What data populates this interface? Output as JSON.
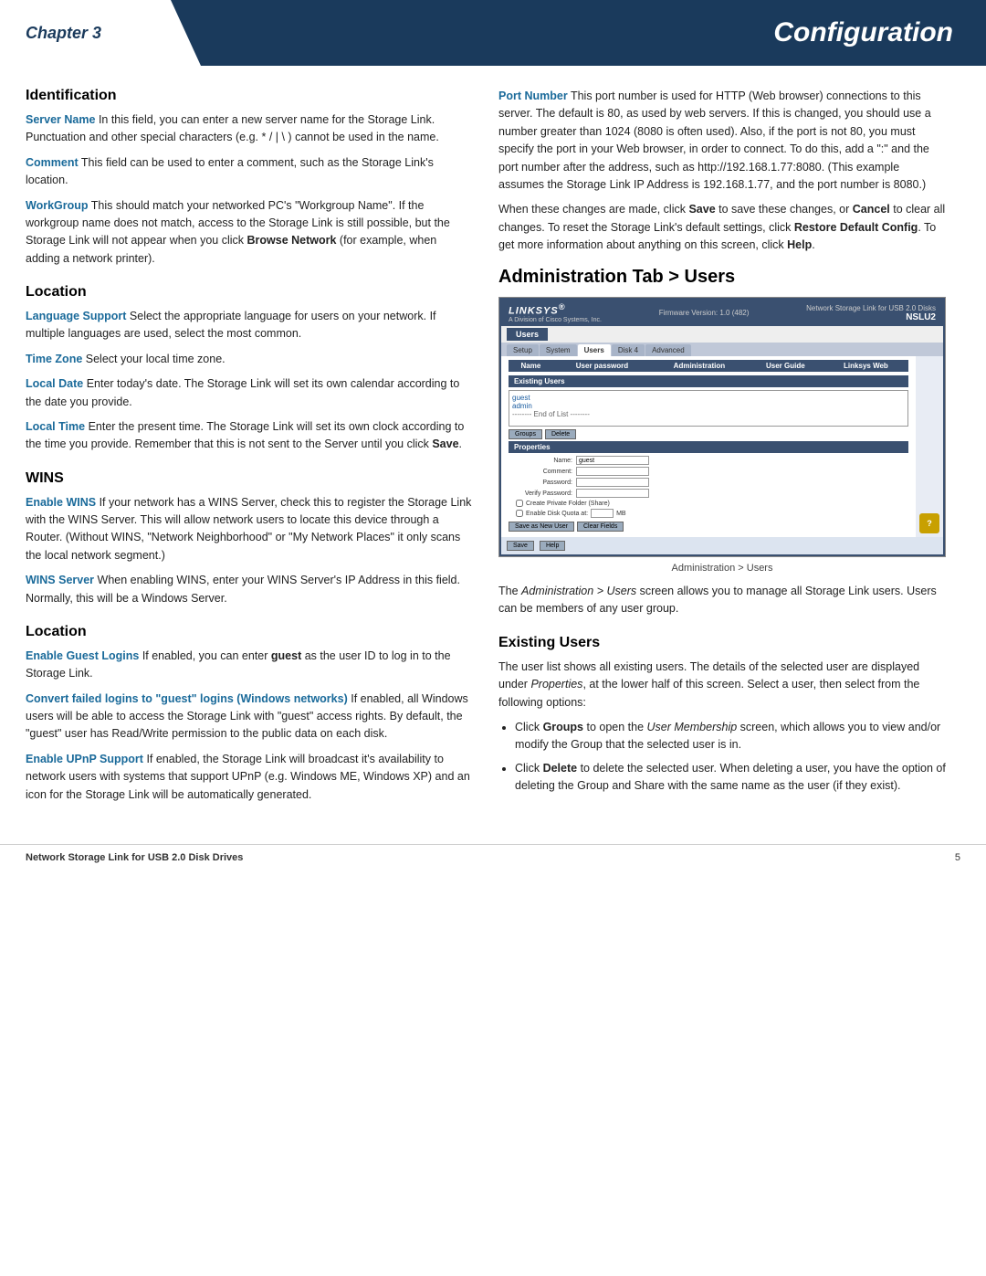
{
  "header": {
    "chapter_label": "Chapter 3",
    "config_title": "Configuration"
  },
  "left_col": {
    "sections": [
      {
        "id": "identification",
        "heading": "Identification",
        "paragraphs": [
          {
            "term": "Server Name",
            "text": " In this field, you can enter a new server name for the Storage Link. Punctuation and other special characters (e.g. * / | \\ ) cannot be used in the name."
          },
          {
            "term": "Comment",
            "text": " This field can be used to enter a comment, such as the Storage Link's location."
          },
          {
            "term": "WorkGroup",
            "text": " This should match your networked PC's \"Workgroup Name\". If the workgroup name does not match, access to the Storage Link is still possible, but the Storage Link will not appear when you click Browse Network (for example, when adding a network printer).",
            "browse_network_bold": true
          }
        ]
      },
      {
        "id": "location",
        "heading": "Location",
        "paragraphs": [
          {
            "term": "Language Support",
            "text": "  Select the appropriate language for users on your network. If multiple languages are used, select the most common."
          },
          {
            "term": "Time Zone",
            "text": "  Select your local time zone."
          },
          {
            "term": "Local Date",
            "text": "  Enter today's date. The Storage Link will set its own calendar according to the date you provide."
          },
          {
            "term": "Local Time",
            "text": " Enter the present time. The Storage Link will set its own clock according to the time you provide. Remember that this is not sent to the Server until you click Save.",
            "save_bold": true
          }
        ]
      },
      {
        "id": "wins",
        "heading": "WINS",
        "paragraphs": [
          {
            "term": "Enable WINS",
            "text": "  If your network has a WINS Server, check this to register the Storage Link with the WINS Server. This will allow network users to locate this device through a Router. (Without WINS, \"Network Neighborhood\" or \"My Network Places\" it only scans the local network segment.)"
          },
          {
            "term": "WINS Server",
            "text": " When enabling WINS, enter your WINS Server's IP Address in this field. Normally, this will be a Windows Server."
          }
        ]
      },
      {
        "id": "location2",
        "heading": "Location",
        "paragraphs": [
          {
            "term": "Enable Guest Logins",
            "text": "  If enabled, you can enter guest as the user ID to log in to the Storage Link.",
            "guest_bold": true
          },
          {
            "term": "Convert failed logins to \"guest\" logins (Windows networks)",
            "text": " If enabled, all Windows users will be able to access the Storage Link with \"guest\" access rights. By default, the \"guest\" user has Read/Write permission to the public data on each disk."
          },
          {
            "term": "Enable UPnP Support",
            "text": "  If enabled, the Storage Link will broadcast it's availability to network users with systems that support UPnP (e.g. Windows ME, Windows XP) and an icon for the Storage Link will be automatically generated."
          }
        ]
      }
    ]
  },
  "right_col": {
    "port_number_para": "Port Number  This port number is used for HTTP (Web browser) connections to this server. The default is 80, as used by web servers. If this is changed, you should use a number greater than 1024 (8080 is often used). Also, if the port is not 80, you must specify the port in your Web browser, in order to connect. To do this, add a \":\" and the port number after the address, such as http://192.168.1.77:8080. (This example assumes the Storage Link IP Address is 192.168.1.77, and the port number is 8080.)",
    "save_cancel_para": "When these changes are made, click Save to save these changes, or Cancel to clear all changes. To reset the Storage Link's default settings, click Restore Default Config. To get more information about anything on this screen, click Help.",
    "admin_heading": "Administration Tab > Users",
    "screenshot": {
      "logo": "LINKSYS®",
      "logo_sub": "A Division of Cisco Systems, Inc.",
      "firmware": "Firmware Version:   1.0 (482)",
      "nav_title": "Users",
      "product_title": "Network Storage Link for USB 2.0 Disks",
      "model": "NSLU2",
      "tabs": [
        "Setup",
        "System",
        "Users",
        "Disk 4",
        "Advanced"
      ],
      "active_tab": "Users",
      "col_headers": [
        "Name",
        "User password",
        "Administration",
        "User Guide",
        "Linksys Web"
      ],
      "existing_users_label": "Existing Users",
      "user_list": [
        "guest",
        "admin",
        "-------- End of List --------"
      ],
      "btn_groups": [
        "Groups",
        "Delete"
      ],
      "properties_label": "Properties",
      "fields": [
        {
          "label": "Name:",
          "value": "guest"
        },
        {
          "label": "Comment:",
          "value": ""
        },
        {
          "label": "Password:",
          "value": ""
        },
        {
          "label": "Verify Password:",
          "value": ""
        }
      ],
      "checkboxes": [
        "Create Private Folder (Share)",
        "Enable Disk Quota at:     MB"
      ],
      "bottom_btns_left": [
        "Save as New User",
        "Clear Fields"
      ],
      "bottom_btns_right": [
        "Save",
        "Help"
      ]
    },
    "screenshot_caption": "Administration > Users",
    "admin_users_para": "The Administration > Users screen allows you to manage all Storage Link users. Users can be members of any user group.",
    "existing_users_heading": "Existing Users",
    "existing_users_para": "The user list shows all existing users. The details of the selected user are displayed under Properties, at the lower half of this screen. Select a user, then select from the following options:",
    "bullets": [
      "Click Groups to open the User Membership screen, which allows you to view and/or modify the Group that the selected user is in.",
      "Click Delete to delete the selected user. When deleting a user, you have the option of deleting the Group and Share with the same name as the user (if they exist)."
    ]
  },
  "footer": {
    "left": "Network Storage Link for USB 2.0 Disk Drives",
    "right": "5"
  }
}
